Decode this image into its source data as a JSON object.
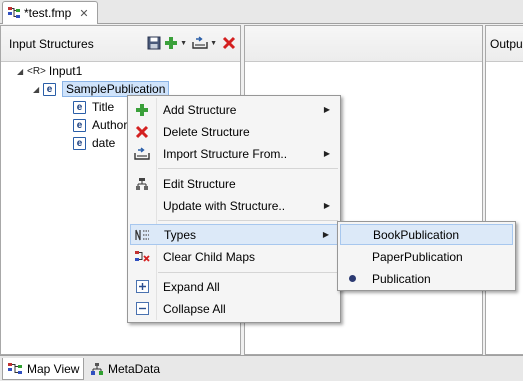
{
  "editor": {
    "tab_title": "*test.fmp"
  },
  "panels": {
    "left": {
      "title": "Input Structures",
      "tree": {
        "root": {
          "badge": "<R>",
          "label": "Input1"
        },
        "selected": {
          "label": "SamplePublication"
        },
        "children": [
          {
            "label": "Title"
          },
          {
            "label": "Author"
          },
          {
            "label": "date"
          }
        ]
      }
    },
    "right": {
      "title": "Outpu"
    }
  },
  "context_menu": {
    "items": [
      {
        "label": "Add Structure"
      },
      {
        "label": "Delete Structure"
      },
      {
        "label": "Import Structure From.."
      },
      {
        "label": "Edit Structure"
      },
      {
        "label": "Update with Structure.."
      },
      {
        "label": "Types"
      },
      {
        "label": "Clear Child Maps"
      },
      {
        "label": "Expand All"
      },
      {
        "label": "Collapse All"
      }
    ],
    "submenu": {
      "items": [
        {
          "label": "BookPublication"
        },
        {
          "label": "PaperPublication"
        },
        {
          "label": "Publication",
          "checked": true
        }
      ]
    }
  },
  "bottom_tabs": [
    {
      "label": "Map View"
    },
    {
      "label": "MetaData"
    }
  ],
  "colors": {
    "add": "#3aa03a",
    "delete": "#d42020",
    "highlight": "#dce9f8",
    "selection": "#cfe3fb"
  }
}
